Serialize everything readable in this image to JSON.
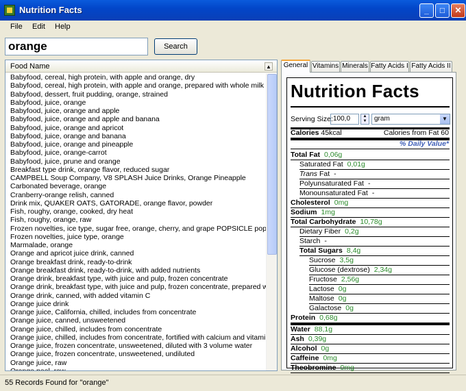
{
  "window": {
    "title": "Nutrition Facts",
    "minimize": "_",
    "maximize": "□",
    "close": "✕"
  },
  "menu": [
    "File",
    "Edit",
    "Help"
  ],
  "search": {
    "value": "orange",
    "button": "Search"
  },
  "list": {
    "header": "Food Name",
    "sort_icon": "chevron-up-icon",
    "items": [
      "Babyfood, cereal, high protein, with apple and orange, dry",
      "Babyfood, cereal, high protein, with apple and orange, prepared with whole milk",
      "Babyfood, dessert, fruit pudding, orange, strained",
      "Babyfood, juice, orange",
      "Babyfood, juice, orange and apple",
      "Babyfood, juice, orange and apple and banana",
      "Babyfood, juice, orange and apricot",
      "Babyfood, juice, orange and banana",
      "Babyfood, juice, orange and pineapple",
      "Babyfood, juice, orange-carrot",
      "Babyfood, juice, prune and orange",
      "Breakfast type drink, orange flavor, reduced sugar",
      "CAMPBELL Soup Company, V8 SPLASH Juice Drinks, Orange Pineapple",
      "Carbonated beverage, orange",
      "Cranberry-orange relish, canned",
      "Drink mix, QUAKER OATS, GATORADE, orange flavor, powder",
      "Fish, roughy, orange, cooked, dry heat",
      "Fish, roughy, orange, raw",
      "Frozen novelties, ice type, sugar free, orange, cherry, and grape POPSICLE pops",
      "Frozen novelties, juice type, orange",
      "Marmalade, orange",
      "Orange and apricot juice drink, canned",
      "Orange breakfast drink, ready-to-drink",
      "Orange breakfast drink, ready-to-drink, with added nutrients",
      "Orange drink, breakfast type, with juice and pulp, frozen concentrate",
      "Orange drink, breakfast type, with juice and pulp, frozen concentrate, prepared with water",
      "Orange drink, canned, with added vitamin C",
      "Orange juice drink",
      "Orange juice, California, chilled, includes from concentrate",
      "Orange juice, canned, unsweetened",
      "Orange juice, chilled, includes from concentrate",
      "Orange juice, chilled, includes from concentrate, fortified with calcium and vitamin D",
      "Orange juice, frozen concentrate, unsweetened, diluted with 3 volume water",
      "Orange juice, frozen concentrate, unsweetened, undiluted",
      "Orange juice, raw",
      "Orange peel, raw"
    ]
  },
  "status": "55 Records Found  for \"orange\"",
  "tabs": [
    "General",
    "Vitamins",
    "Minerals",
    "Fatty Acids I",
    "Fatty Acids II"
  ],
  "nf": {
    "title": "Nutrition Facts",
    "serving_label": "Serving Size:",
    "serving_value": "100,0",
    "unit": "gram",
    "calories_label": "Calories",
    "calories_value": "45kcal",
    "cal_fat": "Calories from Fat 60",
    "daily_value": "% Daily Value*",
    "total_fat": {
      "label": "Total Fat",
      "value": "0,06g"
    },
    "sat_fat": {
      "label": "Saturated Fat",
      "value": "0,01g"
    },
    "trans_fat": {
      "label_i": "Trans",
      "label": " Fat",
      "value": "-"
    },
    "poly_fat": {
      "label": "Polyunsaturated Fat",
      "value": "-"
    },
    "mono_fat": {
      "label": "Monounsaturated Fat",
      "value": "-"
    },
    "cholesterol": {
      "label": "Cholesterol",
      "value": "0mg"
    },
    "sodium": {
      "label": "Sodium",
      "value": "1mg"
    },
    "carb": {
      "label": "Total Carbohydrate",
      "value": "10,78g"
    },
    "fiber": {
      "label": "Dietary Fiber",
      "value": "0,2g"
    },
    "starch": {
      "label": "Starch",
      "value": "-"
    },
    "sugars": {
      "label": "Total Sugars",
      "value": "8,4g"
    },
    "sucrose": {
      "label": "Sucrose",
      "value": "3,5g"
    },
    "glucose": {
      "label": "Glucose (dextrose)",
      "value": "2,34g"
    },
    "fructose": {
      "label": "Fructose",
      "value": "2,56g"
    },
    "lactose": {
      "label": "Lactose",
      "value": "0g"
    },
    "maltose": {
      "label": "Maltose",
      "value": "0g"
    },
    "galactose": {
      "label": "Galactose",
      "value": "0g"
    },
    "protein": {
      "label": "Protein",
      "value": "0,68g"
    },
    "water": {
      "label": "Water",
      "value": "88,1g"
    },
    "ash": {
      "label": "Ash",
      "value": "0,39g"
    },
    "alcohol": {
      "label": "Alcohol",
      "value": "0g"
    },
    "caffeine": {
      "label": "Caffeine",
      "value": "0mg"
    },
    "theobromine": {
      "label": "Theobromine",
      "value": "0mg"
    }
  }
}
